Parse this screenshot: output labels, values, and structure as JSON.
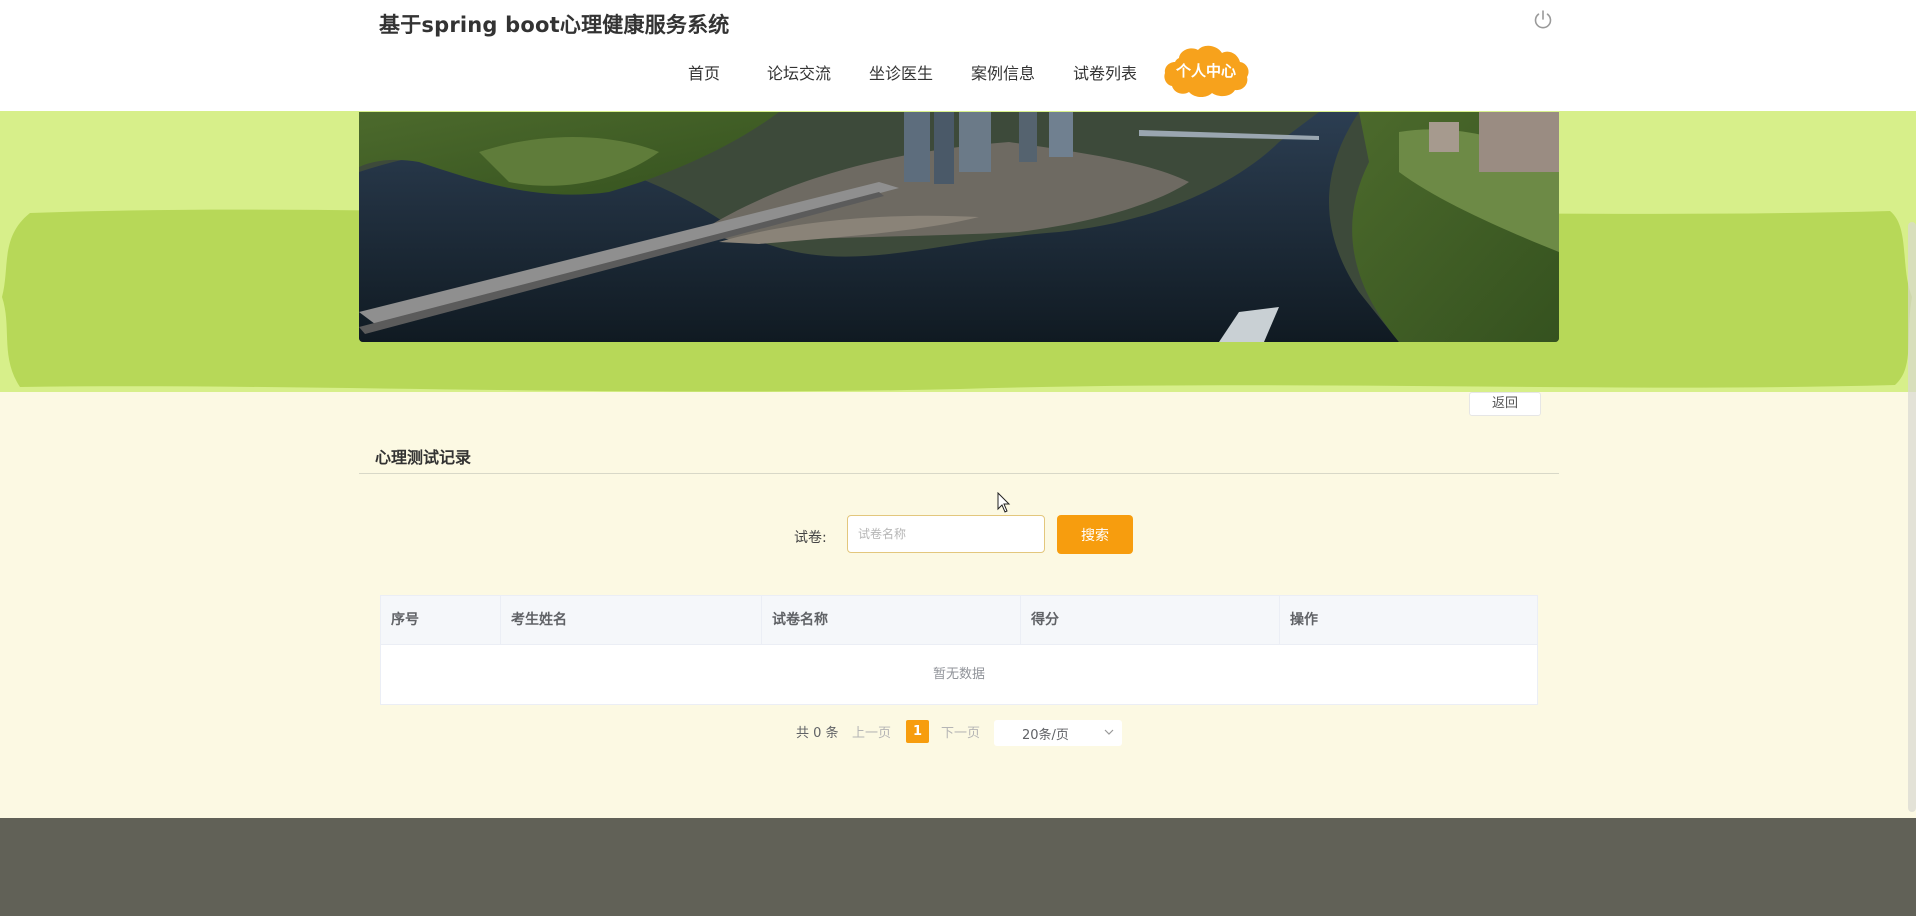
{
  "header": {
    "site_title": "基于spring boot心理健康服务系统",
    "power_icon": "power-icon"
  },
  "nav": {
    "items": [
      {
        "label": "首页"
      },
      {
        "label": "论坛交流"
      },
      {
        "label": "坐诊医生"
      },
      {
        "label": "案例信息"
      },
      {
        "label": "试卷列表"
      }
    ],
    "active": {
      "label": "个人中心"
    },
    "active_color": "#f7a21c"
  },
  "content": {
    "back_label": "返回",
    "section_title": "心理测试记录",
    "search": {
      "label": "试卷:",
      "placeholder": "试卷名称",
      "value": "",
      "button_label": "搜索"
    },
    "table": {
      "columns": [
        "序号",
        "考生姓名",
        "试卷名称",
        "得分",
        "操作"
      ],
      "rows": [],
      "empty_text": "暂无数据"
    },
    "pagination": {
      "total_text": "共 0 条",
      "prev_label": "上一页",
      "current_page": "1",
      "next_label": "下一页",
      "page_size": "20条/页"
    }
  },
  "colors": {
    "accent": "#f79d0e",
    "banner_bg": "#d7ef8a",
    "banner_blob": "#b7d858",
    "page_bg": "#fcf9e3",
    "footer_bg": "#616157"
  }
}
